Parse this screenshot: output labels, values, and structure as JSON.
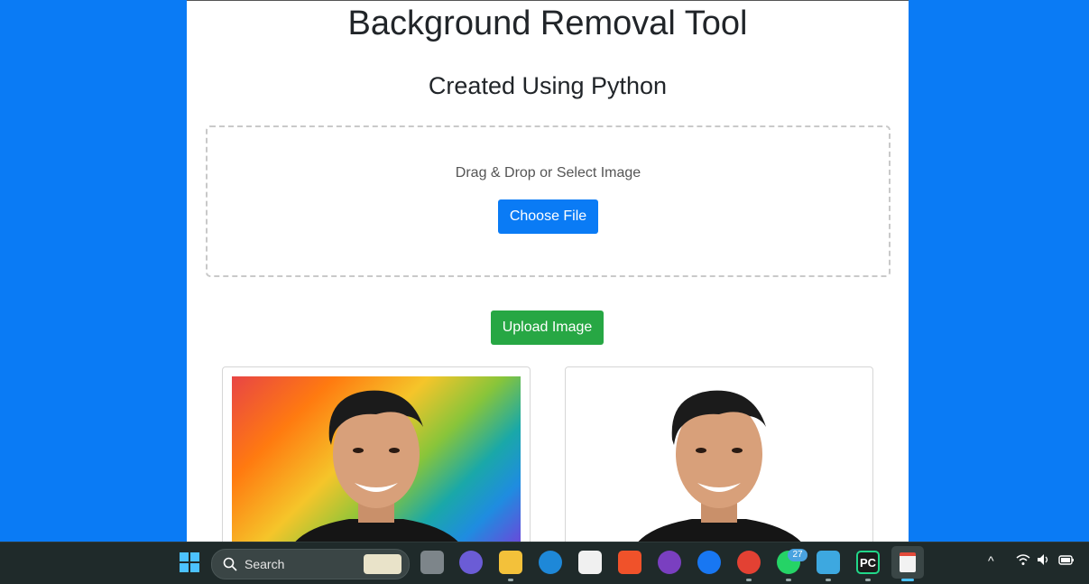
{
  "page": {
    "title": "Background Removal Tool",
    "subtitle": "Created Using Python"
  },
  "dropzone": {
    "text": "Drag & Drop or Select Image",
    "choose_label": "Choose File"
  },
  "actions": {
    "upload_label": "Upload Image"
  },
  "images": {
    "original_alt": "Original photo with rainbow background",
    "result_alt": "Photo with background removed"
  },
  "taskbar": {
    "search_label": "Search",
    "whatsapp_badge": "27",
    "pycharm_label": "PC",
    "icons": [
      "windows-start-icon",
      "search-icon",
      "task-view-icon",
      "chat-icon",
      "file-explorer-icon",
      "edge-icon",
      "store-icon",
      "brave-icon",
      "github-icon",
      "facebook-icon",
      "chrome-icon",
      "whatsapp-icon",
      "notepad-icon",
      "pycharm-icon",
      "snipping-tool-icon",
      "chevron-up-icon",
      "wifi-icon",
      "volume-icon",
      "battery-icon"
    ]
  },
  "colors": {
    "background": "#0a7bf5",
    "primary_button": "#0a7bf5",
    "success_button": "#27a744",
    "taskbar": "#1f2a2a"
  }
}
